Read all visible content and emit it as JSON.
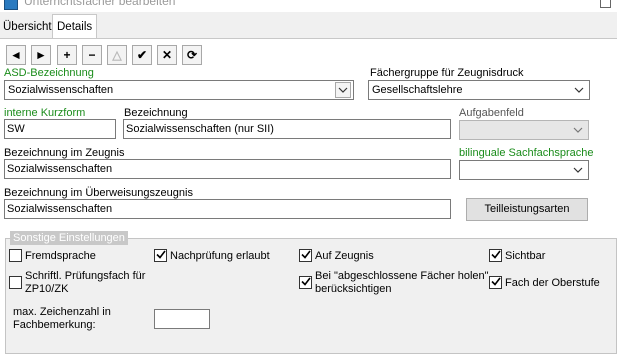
{
  "window": {
    "title": "Unterrichtsfächer bearbeiten"
  },
  "tabs": [
    {
      "label": "Übersicht",
      "active": false
    },
    {
      "label": "Details",
      "active": true
    }
  ],
  "navigator": [
    {
      "name": "prior-record",
      "icon": "◄",
      "enabled": true
    },
    {
      "name": "next-record",
      "icon": "►",
      "enabled": true
    },
    {
      "name": "insert-record",
      "icon": "+",
      "enabled": true
    },
    {
      "name": "delete-record",
      "icon": "−",
      "enabled": true
    },
    {
      "name": "edit-record",
      "icon": "△",
      "enabled": false
    },
    {
      "name": "post-record",
      "icon": "✔",
      "enabled": true
    },
    {
      "name": "cancel-record",
      "icon": "✕",
      "enabled": true
    },
    {
      "name": "refresh-record",
      "icon": "⟳",
      "enabled": true
    }
  ],
  "form": {
    "asd_label": "ASD-Bezeichnung",
    "asd_value": "Sozialwissenschaften",
    "faechergruppe_label": "Fächergruppe für Zeugnisdruck",
    "faechergruppe_value": "Gesellschaftslehre",
    "kurzform_label": "interne Kurzform",
    "kurzform_value": "SW",
    "bezeichnung_label": "Bezeichnung",
    "bezeichnung_value": "Sozialwissenschaften (nur SII)",
    "aufgabenfeld_label": "Aufgabenfeld",
    "aufgabenfeld_value": "",
    "zeugnis_label": "Bezeichnung im Zeugnis",
    "zeugnis_value": "Sozialwissenschaften",
    "bilingual_label": "bilinguale Sachfachsprache",
    "bilingual_value": "",
    "ueberweisung_label": "Bezeichnung im Überweisungszeugnis",
    "ueberweisung_value": "Sozialwissenschaften",
    "teilleistung_button": "Teilleistungsarten"
  },
  "settings": {
    "title": "Sonstige Einstellungen",
    "fremdsprache": {
      "label": "Fremdsprache",
      "checked": false
    },
    "nachpruefung": {
      "label": "Nachprüfung erlaubt",
      "checked": true
    },
    "aufzeugnis": {
      "label": "Auf Zeugnis",
      "checked": true
    },
    "sichtbar": {
      "label": "Sichtbar",
      "checked": true
    },
    "schriftl_line1": "Schriftl. Prüfungsfach für",
    "schriftl_line2": "ZP10/ZK",
    "schriftl_checked": false,
    "abgeschl_line1": "Bei \"abgeschlossene Fächer holen\"",
    "abgeschl_line2": "berücksichtigen",
    "abgeschl_checked": true,
    "oberstufe": {
      "label": "Fach der Oberstufe",
      "checked": true
    },
    "maxzeichen_line1": "max. Zeichenzahl in",
    "maxzeichen_line2": "Fachbemerkung:",
    "maxzeichen_value": ""
  },
  "colors": {
    "green_label": "#1a8c1a",
    "group_header": "#c8c8c8"
  }
}
